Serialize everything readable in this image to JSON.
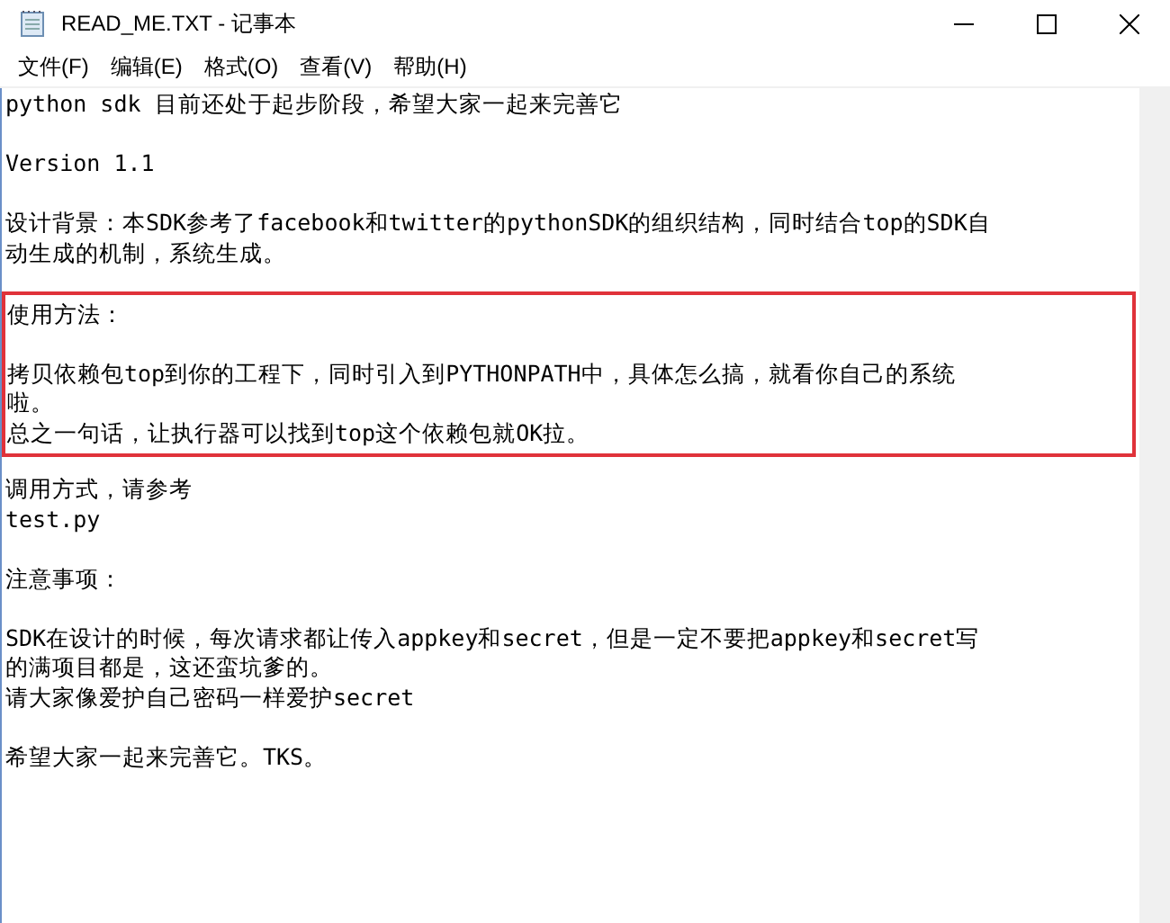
{
  "window": {
    "title": "READ_ME.TXT - 记事本"
  },
  "menu": [
    "文件(F)",
    "编辑(E)",
    "格式(O)",
    "查看(V)",
    "帮助(H)"
  ],
  "document": {
    "blocks": [
      {
        "highlighted": false,
        "paragraphs": [
          [
            "python sdk 目前还处于起步阶段，希望大家一起来完善它"
          ]
        ]
      },
      {
        "highlighted": false,
        "paragraphs": [
          [
            "Version 1.1"
          ]
        ]
      },
      {
        "highlighted": false,
        "paragraphs": [
          [
            "设计背景：本SDK参考了facebook和twitter的pythonSDK的组织结构，同时结合top的SDK自",
            "动生成的机制，系统生成。"
          ]
        ]
      },
      {
        "highlighted": true,
        "paragraphs": [
          [
            "使用方法："
          ],
          [
            "拷贝依赖包top到你的工程下，同时引入到PYTHONPATH中，具体怎么搞，就看你自己的系统",
            "啦。",
            "总之一句话，让执行器可以找到top这个依赖包就OK拉。"
          ]
        ]
      },
      {
        "highlighted": false,
        "paragraphs": [
          [
            "调用方式，请参考",
            "test.py"
          ]
        ]
      },
      {
        "highlighted": false,
        "paragraphs": [
          [
            "注意事项："
          ]
        ]
      },
      {
        "highlighted": false,
        "paragraphs": [
          [
            "SDK在设计的时候，每次请求都让传入appkey和secret，但是一定不要把appkey和secret写",
            "的满项目都是，这还蛮坑爹的。",
            "请大家像爱护自己密码一样爱护secret"
          ]
        ]
      },
      {
        "highlighted": false,
        "paragraphs": [
          [
            "希望大家一起来完善它。TKS。"
          ]
        ]
      }
    ]
  }
}
